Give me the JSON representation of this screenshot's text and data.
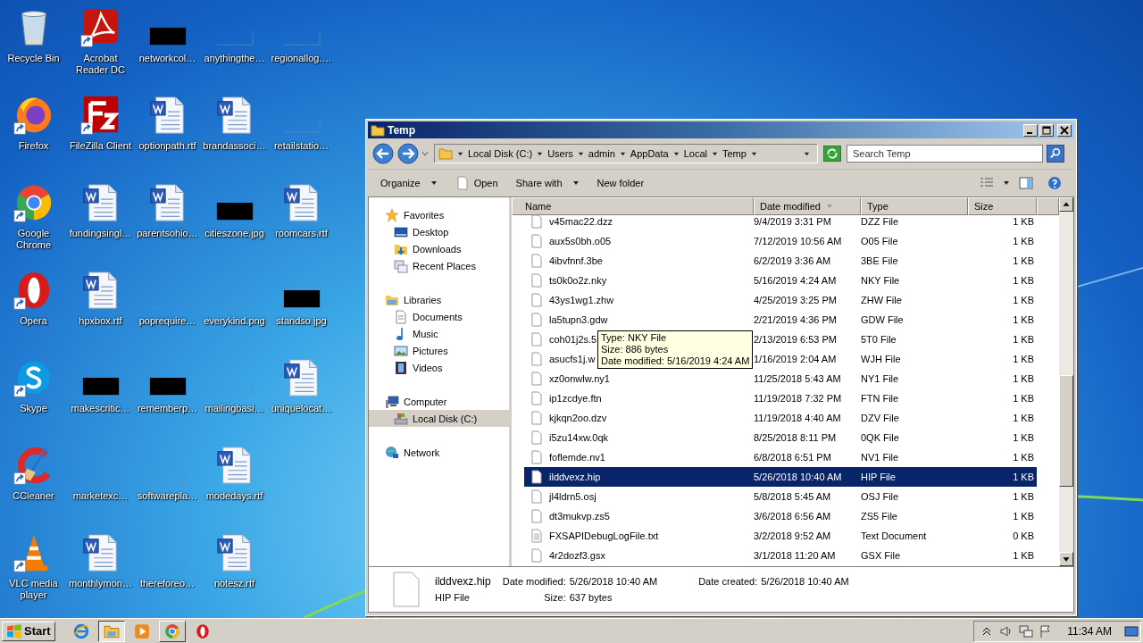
{
  "desktop": {
    "rows": [
      {
        "icons": [
          {
            "label": "Recycle Bin",
            "kind": "recycle"
          },
          {
            "label": "Acrobat Reader DC",
            "kind": "acrobat"
          },
          {
            "label": "networkcol…",
            "kind": "dark"
          },
          {
            "label": "anythingthe…",
            "kind": "blank"
          },
          {
            "label": "regionallog.…",
            "kind": "blank"
          }
        ]
      },
      {
        "icons": [
          {
            "label": "Firefox",
            "kind": "firefox"
          },
          {
            "label": "FileZilla Client",
            "kind": "filezilla"
          },
          {
            "label": "optionpath.rtf",
            "kind": "word"
          },
          {
            "label": "brandassoci…",
            "kind": "word"
          },
          {
            "label": "retailstatio…",
            "kind": "blank"
          }
        ]
      },
      {
        "icons": [
          {
            "label": "Google Chrome",
            "kind": "chrome"
          },
          {
            "label": "fundingsingl…",
            "kind": "word"
          },
          {
            "label": "parentsohio…",
            "kind": "word"
          },
          {
            "label": "citieszone.jpg",
            "kind": "dark"
          },
          {
            "label": "roomcars.rtf",
            "kind": "word"
          }
        ]
      },
      {
        "icons": [
          {
            "label": "Opera",
            "kind": "opera"
          },
          {
            "label": "hpxbox.rtf",
            "kind": "word"
          },
          {
            "label": "poprequire…",
            "kind": "blank"
          },
          {
            "label": "everykind.png",
            "kind": "blank"
          },
          {
            "label": "standso.jpg",
            "kind": "dark"
          }
        ]
      },
      {
        "icons": [
          {
            "label": "Skype",
            "kind": "skype"
          },
          {
            "label": "makescritic…",
            "kind": "dark"
          },
          {
            "label": "rememberp…",
            "kind": "dark"
          },
          {
            "label": "mailingbasi…",
            "kind": "blank"
          },
          {
            "label": "uniquelocat…",
            "kind": "word"
          }
        ]
      },
      {
        "icons": [
          {
            "label": "CCleaner",
            "kind": "ccleaner"
          },
          {
            "label": "marketexc…",
            "kind": "blank"
          },
          {
            "label": "softwarepla…",
            "kind": "blank"
          },
          {
            "label": "modedays.rtf",
            "kind": "word"
          }
        ]
      },
      {
        "icons": [
          {
            "label": "VLC media player",
            "kind": "vlc"
          },
          {
            "label": "monthlymon…",
            "kind": "word"
          },
          {
            "label": "thereforeo…",
            "kind": "blank"
          },
          {
            "label": "notesz.rtf",
            "kind": "word"
          }
        ]
      }
    ]
  },
  "explorer": {
    "title": "Temp",
    "path": [
      "Local Disk (C:)",
      "Users",
      "admin",
      "AppData",
      "Local",
      "Temp"
    ],
    "search": {
      "placeholder": "Search Temp"
    },
    "toolbar": [
      {
        "label": "Organize",
        "kind": "menu"
      },
      {
        "label": "Open",
        "kind": "open"
      },
      {
        "label": "Share with",
        "kind": "menu"
      },
      {
        "label": "New folder",
        "kind": "plain"
      }
    ],
    "nav": [
      {
        "label": "Favorites",
        "kind": "star",
        "selected": false,
        "children": [
          {
            "label": "Desktop",
            "kind": "desktop",
            "selected": false
          },
          {
            "label": "Downloads",
            "kind": "downloads",
            "selected": false
          },
          {
            "label": "Recent Places",
            "kind": "recent",
            "selected": false
          }
        ]
      },
      {
        "label": "Libraries",
        "kind": "library",
        "selected": false,
        "children": [
          {
            "label": "Documents",
            "kind": "documents",
            "selected": false
          },
          {
            "label": "Music",
            "kind": "music",
            "selected": false
          },
          {
            "label": "Pictures",
            "kind": "pictures",
            "selected": false
          },
          {
            "label": "Videos",
            "kind": "videos",
            "selected": false
          }
        ]
      },
      {
        "label": "Computer",
        "kind": "computer",
        "selected": false,
        "children": [
          {
            "label": "Local Disk (C:)",
            "kind": "disk",
            "selected": true
          }
        ]
      },
      {
        "label": "Network",
        "kind": "network",
        "selected": false
      }
    ],
    "columns": [
      {
        "label": "Name",
        "sorted": false
      },
      {
        "label": "Date modified",
        "sorted": true
      },
      {
        "label": "Type",
        "sorted": false
      },
      {
        "label": "Size",
        "sorted": false
      }
    ],
    "rows": [
      {
        "name": "v45mac22.dzz",
        "date": "9/4/2019 3:31 PM",
        "type": "DZZ File",
        "size": "1 KB",
        "kind": "file",
        "selected": false
      },
      {
        "name": "aux5s0bh.o05",
        "date": "7/12/2019 10:56 AM",
        "type": "O05 File",
        "size": "1 KB",
        "kind": "file",
        "selected": false
      },
      {
        "name": "4ibvfnnf.3be",
        "date": "6/2/2019 3:36 AM",
        "type": "3BE File",
        "size": "1 KB",
        "kind": "file",
        "selected": false
      },
      {
        "name": "ts0k0o2z.nky",
        "date": "5/16/2019 4:24 AM",
        "type": "NKY File",
        "size": "1 KB",
        "kind": "file",
        "selected": false
      },
      {
        "name": "43ys1wg1.zhw",
        "date": "4/25/2019 3:25 PM",
        "type": "ZHW File",
        "size": "1 KB",
        "kind": "file",
        "selected": false
      },
      {
        "name": "la5tupn3.gdw",
        "date": "2/21/2019 4:36 PM",
        "type": "GDW File",
        "size": "1 KB",
        "kind": "file",
        "selected": false
      },
      {
        "name": "coh01j2s.5",
        "date": "2/13/2019 6:53 PM",
        "type": "5T0 File",
        "size": "1 KB",
        "kind": "file",
        "selected": false
      },
      {
        "name": "asucfs1j.w",
        "date": "1/16/2019 2:04 AM",
        "type": "WJH File",
        "size": "1 KB",
        "kind": "file",
        "selected": false
      },
      {
        "name": "xz0onwlw.ny1",
        "date": "11/25/2018 5:43 AM",
        "type": "NY1 File",
        "size": "1 KB",
        "kind": "file",
        "selected": false
      },
      {
        "name": "ip1zcdye.ftn",
        "date": "11/19/2018 7:32 PM",
        "type": "FTN File",
        "size": "1 KB",
        "kind": "file",
        "selected": false
      },
      {
        "name": "kjkqn2oo.dzv",
        "date": "11/19/2018 4:40 AM",
        "type": "DZV File",
        "size": "1 KB",
        "kind": "file",
        "selected": false
      },
      {
        "name": "i5zu14xw.0qk",
        "date": "8/25/2018 8:11 PM",
        "type": "0QK File",
        "size": "1 KB",
        "kind": "file",
        "selected": false
      },
      {
        "name": "foflemde.nv1",
        "date": "6/8/2018 6:51 PM",
        "type": "NV1 File",
        "size": "1 KB",
        "kind": "file",
        "selected": false
      },
      {
        "name": "ilddvexz.hip",
        "date": "5/26/2018 10:40 AM",
        "type": "HIP File",
        "size": "1 KB",
        "kind": "file",
        "selected": true
      },
      {
        "name": "jl4ldrn5.osj",
        "date": "5/8/2018 5:45 AM",
        "type": "OSJ File",
        "size": "1 KB",
        "kind": "file",
        "selected": false
      },
      {
        "name": "dt3mukvp.zs5",
        "date": "3/6/2018 6:56 AM",
        "type": "ZS5 File",
        "size": "1 KB",
        "kind": "file",
        "selected": false
      },
      {
        "name": "FXSAPIDebugLogFile.txt",
        "date": "3/2/2018 9:52 AM",
        "type": "Text Document",
        "size": "0 KB",
        "kind": "text",
        "selected": false
      },
      {
        "name": "4r2dozf3.gsx",
        "date": "3/1/2018 11:20 AM",
        "type": "GSX File",
        "size": "1 KB",
        "kind": "file",
        "selected": false
      }
    ],
    "tooltip": [
      "Type: NKY File",
      "Size: 886 bytes",
      "Date modified: 5/16/2019 4:24 AM"
    ],
    "details": {
      "name": "ilddvexz.hip",
      "type": "HIP File",
      "fields": [
        {
          "label": "Date modified:",
          "value": "5/26/2018 10:40 AM"
        },
        {
          "label": "Size:",
          "value": "637 bytes"
        },
        {
          "label": "Date created:",
          "value": "5/26/2018 10:40 AM"
        }
      ]
    }
  },
  "taskbar": {
    "start": "Start",
    "apps": [
      {
        "kind": "ie",
        "active": false,
        "running": false
      },
      {
        "kind": "folder",
        "active": true,
        "running": true
      },
      {
        "kind": "media",
        "active": false,
        "running": false
      },
      {
        "kind": "chrome",
        "active": false,
        "running": true
      },
      {
        "kind": "opera",
        "active": false,
        "running": false
      }
    ],
    "clock": "11:34 AM"
  }
}
